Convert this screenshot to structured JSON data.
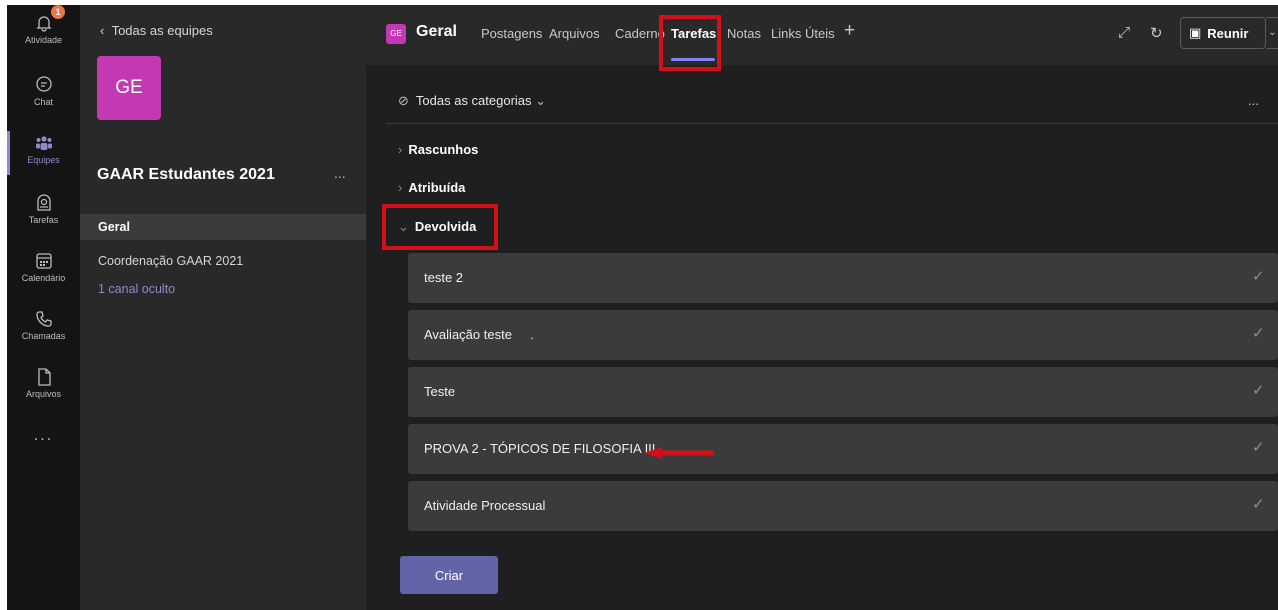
{
  "rail": {
    "items": [
      {
        "label": "Atividade",
        "icon": "bell-icon",
        "badge": "1"
      },
      {
        "label": "Chat",
        "icon": "chat-icon"
      },
      {
        "label": "Equipes",
        "icon": "teams-icon"
      },
      {
        "label": "Tarefas",
        "icon": "assignments-icon"
      },
      {
        "label": "Calendário",
        "icon": "calendar-icon"
      },
      {
        "label": "Chamadas",
        "icon": "phone-icon"
      },
      {
        "label": "Arquivos",
        "icon": "file-icon"
      }
    ],
    "more": "..."
  },
  "teampanel": {
    "back_label": "Todas as equipes",
    "team_initials": "GE",
    "team_name": "GAAR Estudantes 2021",
    "team_more": "...",
    "channels": [
      "Geral",
      "Coordenação GAAR 2021"
    ],
    "hidden_channels": "1 canal oculto"
  },
  "header": {
    "channel_initials": "GE",
    "channel_name": "Geral",
    "tabs": [
      "Postagens",
      "Arquivos",
      "Caderno",
      "Tarefas",
      "Notas",
      "Links Úteis"
    ],
    "active_tab": "Tarefas",
    "add_tab": "+",
    "meet_label": "Reunir"
  },
  "filter": {
    "label": "Todas as categorias",
    "more": "..."
  },
  "sections": {
    "drafts": "Rascunhos",
    "assigned": "Atribuída",
    "returned": "Devolvida"
  },
  "assignments": [
    "teste 2",
    "Avaliação teste     .",
    "Teste",
    "PROVA 2 - TÓPICOS DE FILOSOFIA III",
    "Atividade Processual"
  ],
  "create_button": "Criar",
  "colors": {
    "accent": "#6264a7",
    "team_avatar": "#c239b3",
    "highlight": "#d20f1a",
    "badge": "#e97548"
  }
}
